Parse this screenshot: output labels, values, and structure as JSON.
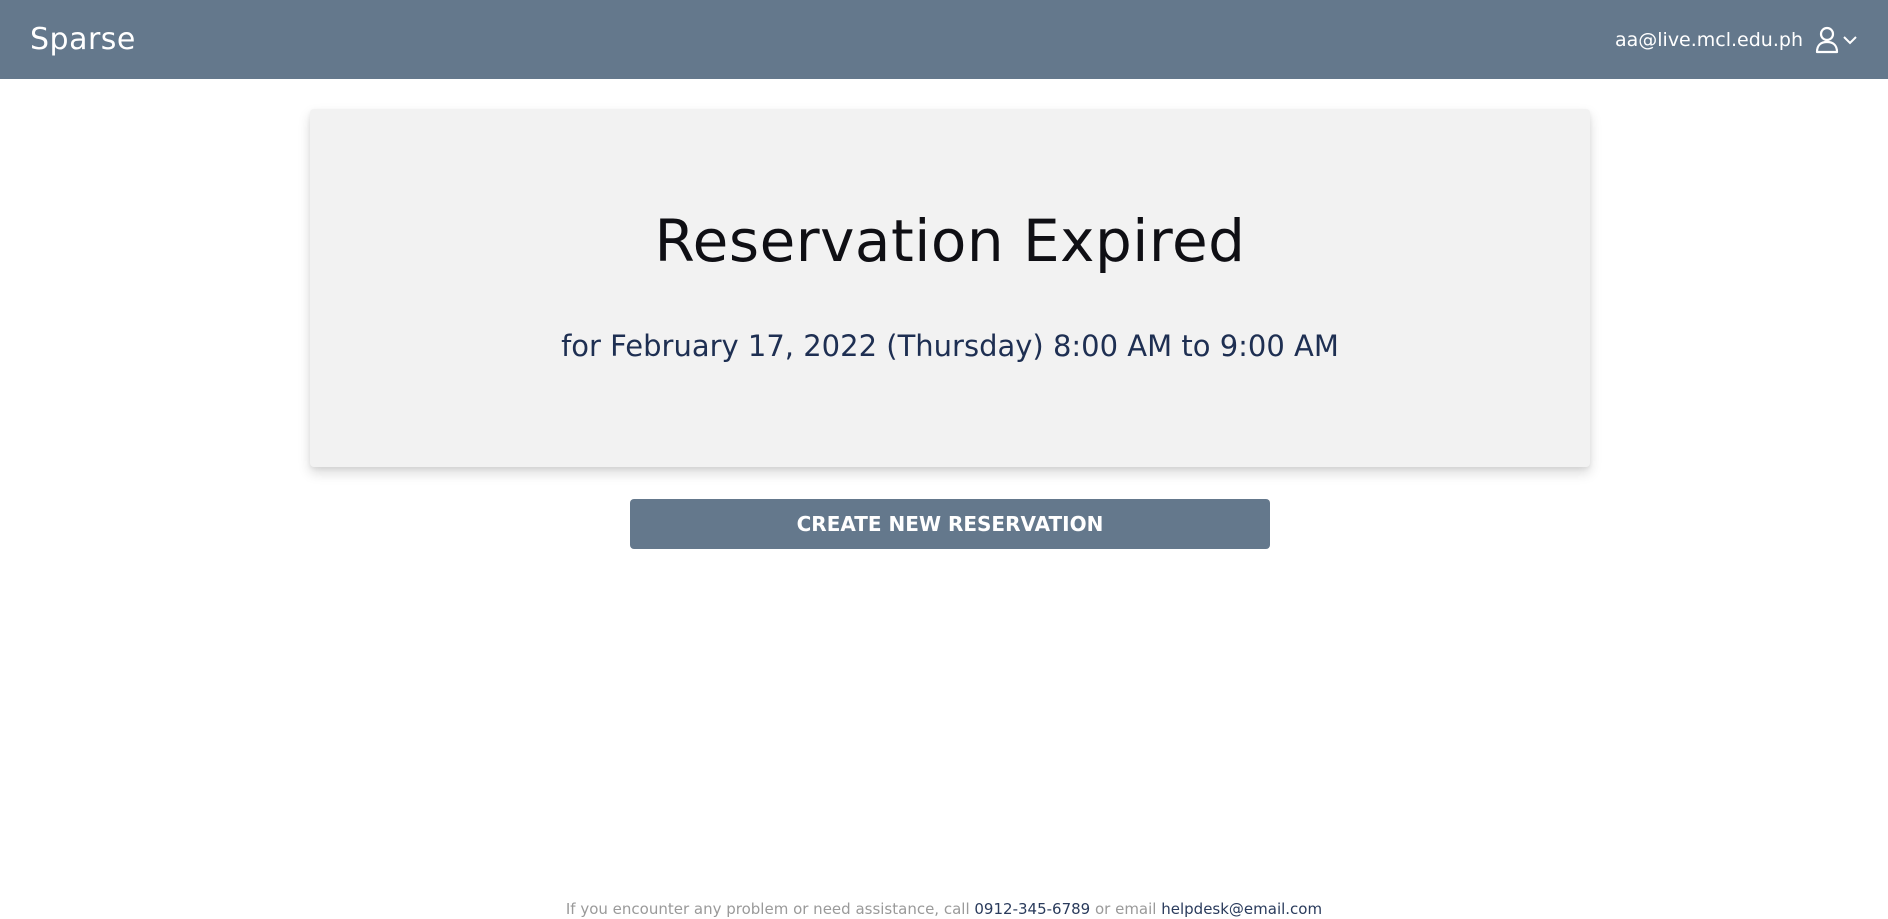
{
  "navbar": {
    "brand": "Sparse",
    "user_email": "aa@live.mcl.edu.ph",
    "user_icon": "user-icon",
    "dropdown_icon": "chevron-down-icon",
    "background_color": "#64788c"
  },
  "card": {
    "title": "Reservation Expired",
    "subtitle": "for February 17, 2022 (Thursday) 8:00 AM to 9:00 AM"
  },
  "actions": {
    "create_label": "CREATE NEW RESERVATION"
  },
  "footer": {
    "prefix": "If you encounter any problem or need assistance, call",
    "phone": "0912-345-6789",
    "middle": "or email",
    "email": "helpdesk@email.com"
  }
}
